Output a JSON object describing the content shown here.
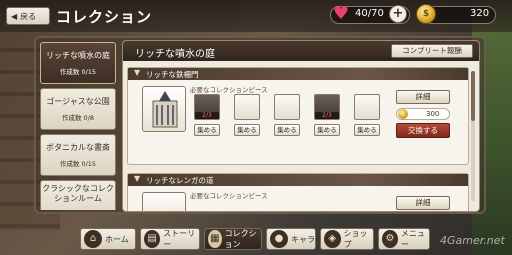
{
  "header": {
    "back_label": "戻る",
    "title": "コレクション",
    "stamina": "40/70",
    "coins": "320"
  },
  "tabs": [
    {
      "name": "リッチな噴水の庭",
      "count": "作成数 0/15",
      "active": true
    },
    {
      "name": "ゴージャスな公園",
      "count": "作成数 0/8",
      "active": false
    },
    {
      "name": "ボタニカルな書斎",
      "count": "作成数 0/15",
      "active": false
    },
    {
      "name": "クラシックなコレクションルーム",
      "count": "",
      "active": false
    }
  ],
  "panel": {
    "title": "リッチな噴水の庭",
    "complete_button": "コンプリート報酬"
  },
  "cards": [
    {
      "title": "リッチな鉄柵門",
      "required_label": "必要なコレクションピース",
      "pieces": [
        {
          "count": "2/3",
          "collect": "集める"
        },
        {
          "count": "",
          "collect": "集める"
        },
        {
          "count": "",
          "collect": "集める"
        },
        {
          "count": "2/3",
          "collect": "集める"
        },
        {
          "count": "",
          "collect": "集める"
        }
      ],
      "detail_button": "詳細",
      "cost": "300",
      "exchange_button": "交換する"
    },
    {
      "title": "リッチなレンガの道",
      "required_label": "必要なコレクションピース",
      "detail_button": "詳細"
    }
  ],
  "nav": {
    "home": "ホーム",
    "story": "ストーリー",
    "collection": "コレクション",
    "chara": "キャラ",
    "shop": "ショップ",
    "menu": "メニュー"
  },
  "watermark": "4Gamer.net",
  "colors": {
    "accent_red": "#b44a36",
    "heart": "#e8446a",
    "coin": "#d9a520"
  }
}
